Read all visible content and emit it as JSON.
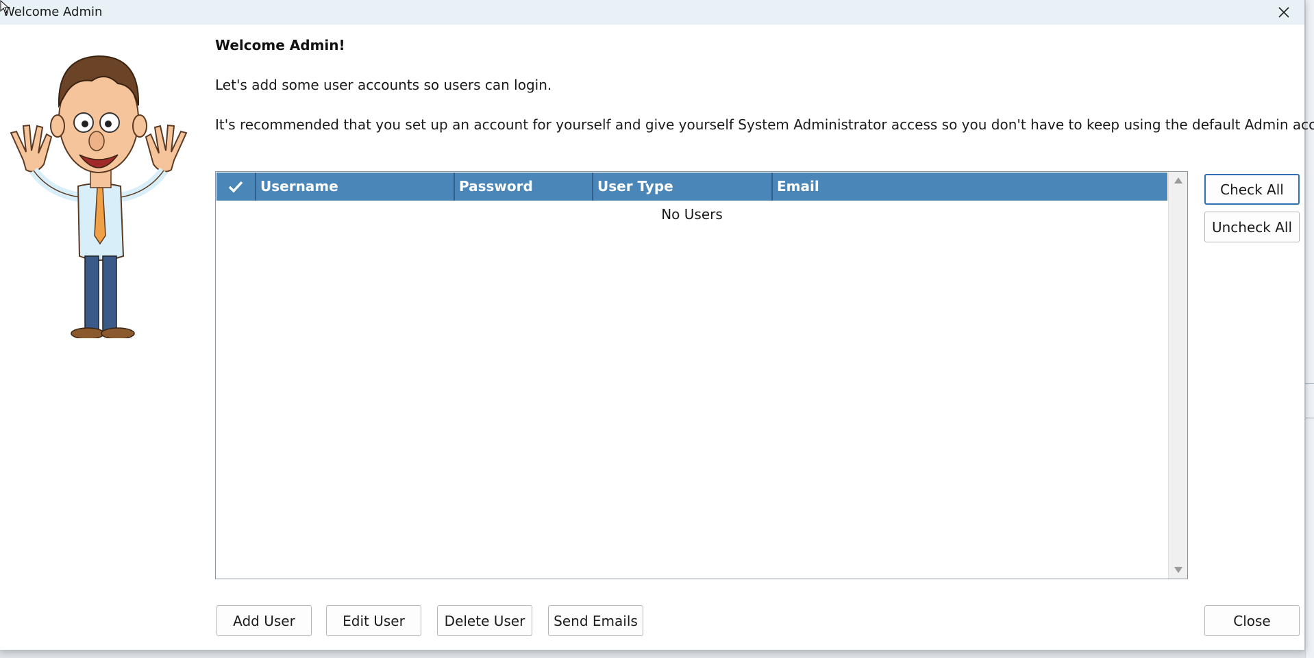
{
  "window": {
    "title": "Welcome Admin"
  },
  "content": {
    "heading": "Welcome Admin!",
    "paragraph1": "Let's add some user accounts so users can login.",
    "paragraph2": "It's recommended that you set up an account for yourself and give yourself System Administrator access so you don't have to keep using the default Admin account."
  },
  "grid": {
    "columns": [
      "Username",
      "Password",
      "User Type",
      "Email"
    ],
    "rows": [],
    "empty_message": "No Users",
    "header_color": "#4a86b8"
  },
  "side_buttons": {
    "check_all": "Check All",
    "uncheck_all": "Uncheck All"
  },
  "bottom_buttons": {
    "add_user": "Add User",
    "edit_user": "Edit User",
    "delete_user": "Delete User",
    "send_emails": "Send Emails",
    "close": "Close"
  },
  "icons": {
    "close": "close-icon",
    "header_check": "checkmark-icon",
    "mascot": "waving-cartoon-man"
  }
}
